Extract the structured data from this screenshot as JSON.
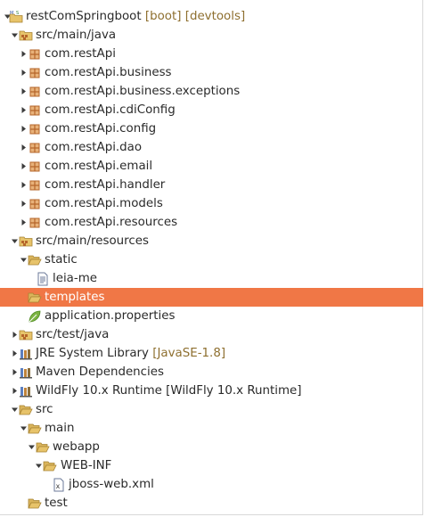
{
  "tree": {
    "selected_index": 15,
    "nodes": [
      {
        "label": "restComSpringboot",
        "decoration": " [boot] [devtools]",
        "icon": "project-icon",
        "arrow": "down"
      },
      {
        "label": "src/main/java",
        "decoration": "",
        "icon": "source-folder-icon",
        "arrow": "down"
      },
      {
        "label": "com.restApi",
        "decoration": "",
        "icon": "package-icon",
        "arrow": "right"
      },
      {
        "label": "com.restApi.business",
        "decoration": "",
        "icon": "package-icon",
        "arrow": "right"
      },
      {
        "label": "com.restApi.business.exceptions",
        "decoration": "",
        "icon": "package-icon",
        "arrow": "right"
      },
      {
        "label": "com.restApi.cdiConfig",
        "decoration": "",
        "icon": "package-icon",
        "arrow": "right"
      },
      {
        "label": "com.restApi.config",
        "decoration": "",
        "icon": "package-icon",
        "arrow": "right"
      },
      {
        "label": "com.restApi.dao",
        "decoration": "",
        "icon": "package-icon",
        "arrow": "right"
      },
      {
        "label": "com.restApi.email",
        "decoration": "",
        "icon": "package-icon",
        "arrow": "right"
      },
      {
        "label": "com.restApi.handler",
        "decoration": "",
        "icon": "package-icon",
        "arrow": "right"
      },
      {
        "label": "com.restApi.models",
        "decoration": "",
        "icon": "package-icon",
        "arrow": "right"
      },
      {
        "label": "com.restApi.resources",
        "decoration": "",
        "icon": "package-icon",
        "arrow": "right"
      },
      {
        "label": "src/main/resources",
        "decoration": "",
        "icon": "source-folder-icon",
        "arrow": "down"
      },
      {
        "label": "static",
        "decoration": "",
        "icon": "folder-open-icon",
        "arrow": "down"
      },
      {
        "label": "leia-me",
        "decoration": "",
        "icon": "text-file-icon",
        "arrow": "none"
      },
      {
        "label": "templates",
        "decoration": "",
        "icon": "folder-open-icon",
        "arrow": "none"
      },
      {
        "label": "application.properties",
        "decoration": "",
        "icon": "spring-leaf-icon",
        "arrow": "none"
      },
      {
        "label": "src/test/java",
        "decoration": "",
        "icon": "source-folder-icon",
        "arrow": "right"
      },
      {
        "label": "JRE System Library",
        "decoration": " [JavaSE-1.8]",
        "icon": "library-icon",
        "arrow": "right"
      },
      {
        "label": "Maven Dependencies",
        "decoration": "",
        "icon": "library-icon",
        "arrow": "right"
      },
      {
        "label": "WildFly 10.x Runtime [WildFly 10.x Runtime]",
        "decoration": "",
        "icon": "library-icon",
        "arrow": "right"
      },
      {
        "label": "src",
        "decoration": "",
        "icon": "folder-open-icon",
        "arrow": "down"
      },
      {
        "label": "main",
        "decoration": "",
        "icon": "folder-open-icon",
        "arrow": "down"
      },
      {
        "label": "webapp",
        "decoration": "",
        "icon": "folder-open-icon",
        "arrow": "down"
      },
      {
        "label": "WEB-INF",
        "decoration": "",
        "icon": "folder-open-icon",
        "arrow": "down"
      },
      {
        "label": "jboss-web.xml",
        "decoration": "",
        "icon": "xml-file-icon",
        "arrow": "none"
      },
      {
        "label": "test",
        "decoration": "",
        "icon": "folder-open-icon",
        "arrow": "none"
      }
    ]
  },
  "colors": {
    "selection": "#f07746",
    "decoration": "#8e6f2f",
    "folder": "#e7c36a",
    "package": "#b5652a",
    "leaf": "#7cb342",
    "library": "#8a6d3b"
  }
}
